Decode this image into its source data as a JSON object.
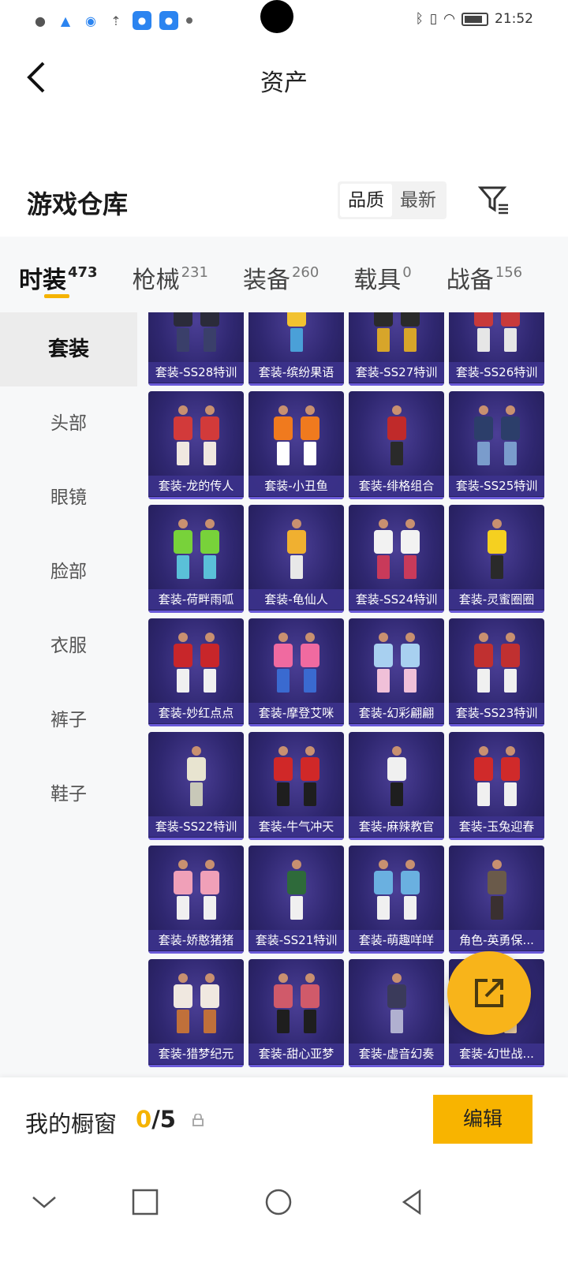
{
  "status_bar": {
    "time": "21:52",
    "left_icons": [
      "wechat-icon",
      "qq-icon",
      "qq-browser-icon",
      "upload-icon",
      "app-box-icon",
      "app-box-icon",
      "dot-icon"
    ],
    "right_icons": [
      "bluetooth-icon",
      "vibrate-icon",
      "wifi-icon",
      "battery-icon"
    ]
  },
  "header": {
    "title": "资产",
    "back_icon": "chevron-left-icon"
  },
  "warehouse": {
    "title": "游戏仓库",
    "sort_options": [
      "品质",
      "最新"
    ],
    "active_sort": "品质",
    "filter_icon": "filter-icon"
  },
  "tabs": [
    {
      "label": "时装",
      "count": "473",
      "active": true
    },
    {
      "label": "枪械",
      "count": "231",
      "active": false
    },
    {
      "label": "装备",
      "count": "260",
      "active": false
    },
    {
      "label": "载具",
      "count": "0",
      "active": false
    },
    {
      "label": "战备",
      "count": "156",
      "active": false
    }
  ],
  "side_menu": [
    {
      "label": "套装",
      "active": true
    },
    {
      "label": "头部",
      "active": false
    },
    {
      "label": "眼镜",
      "active": false
    },
    {
      "label": "脸部",
      "active": false
    },
    {
      "label": "衣服",
      "active": false
    },
    {
      "label": "裤子",
      "active": false
    },
    {
      "label": "鞋子",
      "active": false
    }
  ],
  "items": [
    {
      "label": "套装-SS28特训",
      "c1": "#2b2b3a",
      "c2": "#3a3f6a"
    },
    {
      "label": "套装-缤纷果语",
      "c1": "#f2c230",
      "c2": "#4aa0d8"
    },
    {
      "label": "套装-SS27特训",
      "c1": "#2a2a2a",
      "c2": "#d7a52a"
    },
    {
      "label": "套装-SS26特训",
      "c1": "#c83a3a",
      "c2": "#e6e6e6"
    },
    {
      "label": "套装-龙的传人",
      "c1": "#d23a3a",
      "c2": "#f0e8e0"
    },
    {
      "label": "套装-小丑鱼",
      "c1": "#f07a1e",
      "c2": "#ffffff"
    },
    {
      "label": "套装-绯格组合",
      "c1": "#c02a2a",
      "c2": "#2a2a2a"
    },
    {
      "label": "套装-SS25特训",
      "c1": "#2c3e6a",
      "c2": "#7a9ccc"
    },
    {
      "label": "套装-荷畔雨呱",
      "c1": "#78d23a",
      "c2": "#5ac0d8"
    },
    {
      "label": "套装-龟仙人",
      "c1": "#f0b030",
      "c2": "#e8e8e8"
    },
    {
      "label": "套装-SS24特训",
      "c1": "#f2f2f2",
      "c2": "#c83a5a"
    },
    {
      "label": "套装-灵蜜圈圈",
      "c1": "#f5d020",
      "c2": "#2a2a2a"
    },
    {
      "label": "套装-妙红点点",
      "c1": "#c8262a",
      "c2": "#f0f0f0"
    },
    {
      "label": "套装-摩登艾咪",
      "c1": "#f06aa0",
      "c2": "#3a6ad0"
    },
    {
      "label": "套装-幻彩翩翩",
      "c1": "#a8d0f0",
      "c2": "#f0c0d8"
    },
    {
      "label": "套装-SS23特训",
      "c1": "#c03030",
      "c2": "#f0f0f0"
    },
    {
      "label": "套装-SS22特训",
      "c1": "#e8e4d0",
      "c2": "#c8c8b8"
    },
    {
      "label": "套装-牛气冲天",
      "c1": "#d02828",
      "c2": "#1e1e1e"
    },
    {
      "label": "套装-麻辣教官",
      "c1": "#f0f0f0",
      "c2": "#1e1e1e"
    },
    {
      "label": "套装-玉兔迎春",
      "c1": "#d02a2a",
      "c2": "#f0f0f0"
    },
    {
      "label": "套装-娇憨猪猪",
      "c1": "#f0a0b8",
      "c2": "#f0f0f0"
    },
    {
      "label": "套装-SS21特训",
      "c1": "#2e6a3a",
      "c2": "#f0f0f0"
    },
    {
      "label": "套装-萌趣咩咩",
      "c1": "#6ab0e0",
      "c2": "#f0f0f0"
    },
    {
      "label": "角色-英勇保...",
      "c1": "#6a5a4a",
      "c2": "#3a3030"
    },
    {
      "label": "套装-猎梦纪元",
      "c1": "#f0e8e0",
      "c2": "#c0703a"
    },
    {
      "label": "套装-甜心亚梦",
      "c1": "#d05a6a",
      "c2": "#1e1e1e"
    },
    {
      "label": "套装-虚音幻奏",
      "c1": "#3a3a5a",
      "c2": "#b0b0d0"
    },
    {
      "label": "套装-幻世战...",
      "c1": "#c03a3a",
      "c2": "#f0d0a0"
    }
  ],
  "showcase": {
    "label": "我的橱窗",
    "current": "0",
    "total": "/5",
    "lock_icon": "lock-icon",
    "edit_label": "编辑"
  },
  "floating_button": {
    "icon": "share-icon"
  },
  "system_nav": [
    "chevron-down-icon",
    "square-icon",
    "circle-icon",
    "triangle-back-icon"
  ],
  "colors": {
    "accent": "#f8b400",
    "card_bg": "#2f2770",
    "card_label_bg": "#3c328c"
  }
}
